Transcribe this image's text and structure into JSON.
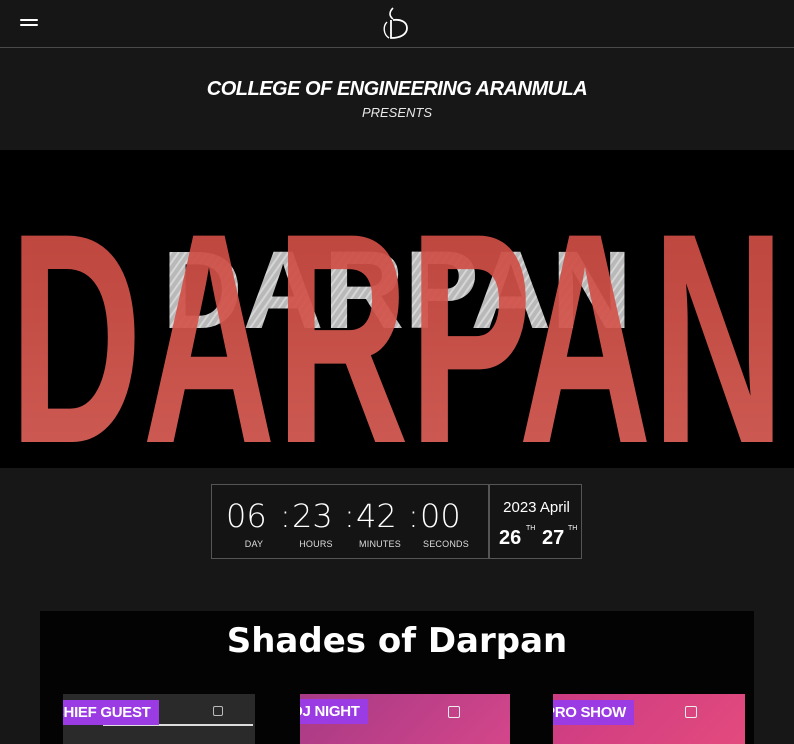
{
  "header": {
    "menu_icon": "hamburger-menu-icon",
    "logo_icon": "darpan-logo-icon"
  },
  "intro": {
    "college": "COLLEGE OF ENGINEERING ARANMULA",
    "presents": "PRESENTS"
  },
  "banner": {
    "title": "DARPAN",
    "inner_title": "DARPAN",
    "colors": {
      "title": "#d9534a",
      "inner": "#b8b8b8",
      "background": "#000000"
    }
  },
  "countdown": {
    "days": "06",
    "hours": "23",
    "minutes": "42",
    "seconds": "00",
    "separator": ":",
    "labels": {
      "day": "DAY",
      "hours": "HOURS",
      "minutes": "MINUTES",
      "seconds": "SECONDS"
    }
  },
  "event_date": {
    "year_month": "2023 April",
    "day1": "26",
    "day1_suffix": "TH",
    "day2": "27",
    "day2_suffix": "TH"
  },
  "shades": {
    "title": "Shades of Darpan",
    "cards": [
      {
        "badge": "CHIEF GUEST",
        "colors": {
          "bg": "#2a2a2a",
          "badge": "#9b3be3"
        }
      },
      {
        "badge": "DJ NIGHT",
        "colors": {
          "bg": "#c0407a",
          "badge": "#9b3be3"
        }
      },
      {
        "badge": "PRO SHOW",
        "colors": {
          "bg": "#d93a7a",
          "badge": "#9b3be3"
        }
      }
    ]
  }
}
